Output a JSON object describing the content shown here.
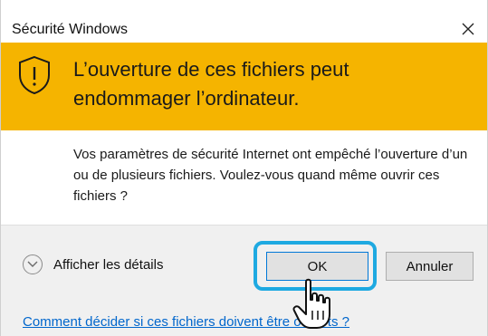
{
  "window": {
    "title": "Sécurité Windows",
    "close_icon": "close-icon"
  },
  "banner": {
    "icon": "warning-shield-icon",
    "text": "L’ouverture de ces fichiers peut endommager l’ordinateur.",
    "color": "#f5b400"
  },
  "message": {
    "text": "Vos paramètres de sécurité Internet ont empêché l’ouverture d’un ou de plusieurs fichiers. Voulez-vous quand même ouvrir ces fichiers ?"
  },
  "footer": {
    "details_label": "Afficher les détails",
    "ok_label": "OK",
    "cancel_label": "Annuler",
    "help_link": "Comment décider si ces fichiers doivent être ouverts ?",
    "highlight_color": "#1ea9e1"
  },
  "cursor": {
    "icon": "hand-pointer-icon"
  }
}
